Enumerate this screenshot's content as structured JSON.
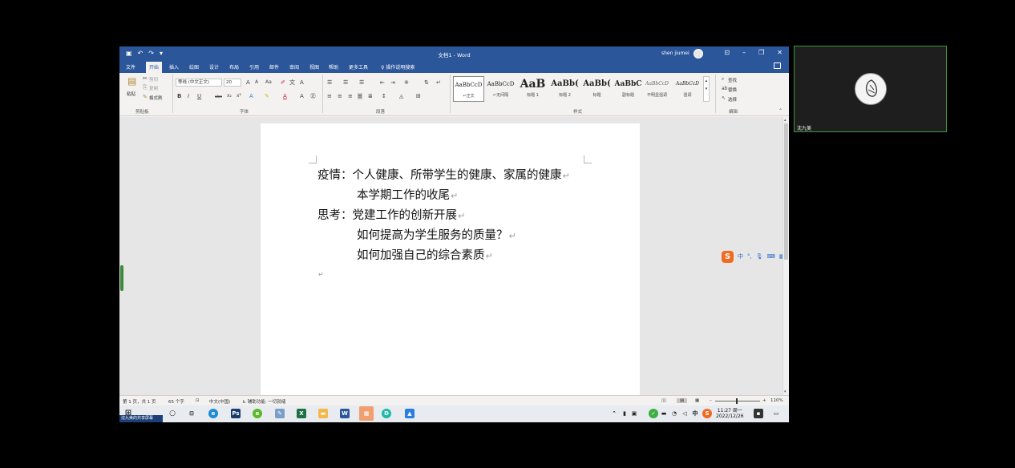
{
  "word": {
    "doc_title": "文档1  -  Word",
    "user_name": "shen jiumei",
    "menu_tabs": [
      "文件",
      "开始",
      "插入",
      "绘图",
      "设计",
      "布局",
      "引用",
      "邮件",
      "审阅",
      "视图",
      "帮助",
      "更多工具"
    ],
    "active_tab_index": 1,
    "tell_me": "操作说明搜索",
    "ribbon": {
      "clipboard": {
        "paste": "粘贴",
        "cut": "剪切",
        "copy": "复制",
        "format_painter": "格式刷",
        "label": "剪贴板"
      },
      "font": {
        "font_name": "等线 (中文正文)",
        "font_size": "20",
        "label": "字体"
      },
      "paragraph": {
        "label": "段落"
      },
      "styles": {
        "label": "样式",
        "items": [
          {
            "sample": "AaBbCcD",
            "name": "↵正文"
          },
          {
            "sample": "AaBbCcD",
            "name": "↵无间隔"
          },
          {
            "sample": "AaB",
            "name": "标题 1"
          },
          {
            "sample": "AaBb(",
            "name": "标题 2"
          },
          {
            "sample": "AaBb(",
            "name": "标题"
          },
          {
            "sample": "AaBbC",
            "name": "副标题"
          },
          {
            "sample": "AaBbCcD",
            "name": "不明显强调"
          },
          {
            "sample": "AaBbCcD",
            "name": "强调"
          }
        ]
      },
      "editing": {
        "find": "查找",
        "replace": "替换",
        "select": "选择",
        "label": "编辑"
      }
    },
    "document": {
      "lines": [
        "疫情：个人健康、所带学生的健康、家属的健康",
        "本学期工作的收尾",
        "思考：党建工作的创新开展",
        "如何提高为学生服务的质量？",
        "如何加强自己的综合素质"
      ],
      "paragraph_mark": "↵"
    },
    "status": {
      "page": "第 1 页，共 1 页",
      "words": "65 个字",
      "language": "中文(中国)",
      "accessibility": "辅助功能: 一切就绪",
      "zoom": "110%"
    },
    "ime": {
      "mode": "中"
    }
  },
  "taskbar": {
    "sharing_label": "沈九美的共享屏幕",
    "time": "11:27 周一",
    "date": "2022/12/26"
  },
  "video": {
    "participant_name": "沈九美"
  },
  "colors": {
    "word_blue": "#2b579a",
    "ribbon_bg": "#f3f2f1",
    "doc_bg": "#e6e6e6",
    "active_speaker": "#3c9a3c"
  }
}
